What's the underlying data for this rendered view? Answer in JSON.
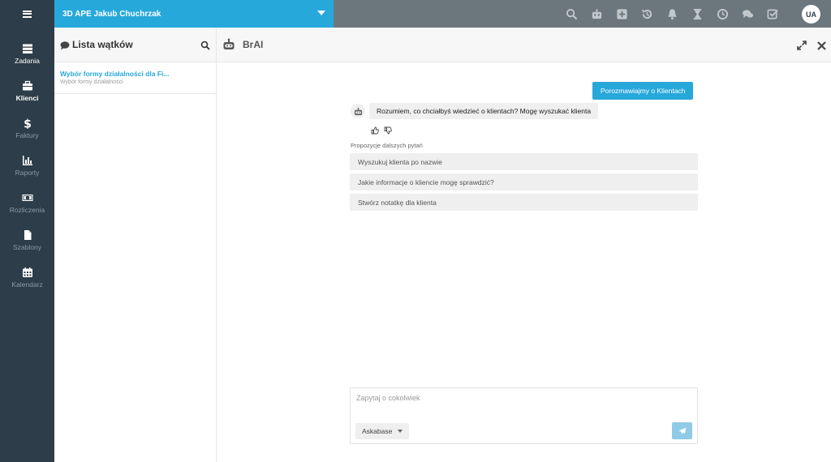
{
  "topbar": {
    "company": "3D APE Jakub Chuchrzak",
    "avatar_initials": "UA",
    "icons": [
      "search-icon",
      "robot-icon",
      "plus-square-icon",
      "history-icon",
      "bell-icon",
      "hourglass-icon",
      "clock-icon",
      "comments-icon",
      "check-square-icon"
    ]
  },
  "sidebar": {
    "items": [
      {
        "label": "Zadania",
        "icon": "tasks-icon"
      },
      {
        "label": "Klienci",
        "icon": "briefcase-icon"
      },
      {
        "label": "Faktury",
        "icon": "dollar-icon"
      },
      {
        "label": "Raporty",
        "icon": "bar-chart-icon"
      },
      {
        "label": "Rozliczenia",
        "icon": "money-icon"
      },
      {
        "label": "Szablony",
        "icon": "file-icon"
      },
      {
        "label": "Kalendarz",
        "icon": "calendar-icon"
      }
    ]
  },
  "threads": {
    "title": "Lista wątków",
    "items": [
      {
        "title": "Wybór formy działalności dla Fi...",
        "subtitle": "Wybór formy działalności"
      }
    ]
  },
  "chat": {
    "title": "BrAI",
    "user_message": "Porozmawiajmy o Klientach",
    "bot_message": "Rozumiem, co chciałbyś wiedzieć o klientach? Mogę wyszukać klienta",
    "suggestions_label": "Propozycje dalszych pytań",
    "suggestions": [
      "Wyszukuj klienta po nazwie",
      "Jakie informacje o kliencie mogę sprawdzić?",
      "Stwórz notatkę dla klienta"
    ],
    "input_placeholder": "Zapytaj o cokolwiek",
    "model": "Askabase"
  },
  "colors": {
    "accent": "#27a8db",
    "sidebar": "#2d3e4a",
    "topbar": "#6b777d"
  }
}
